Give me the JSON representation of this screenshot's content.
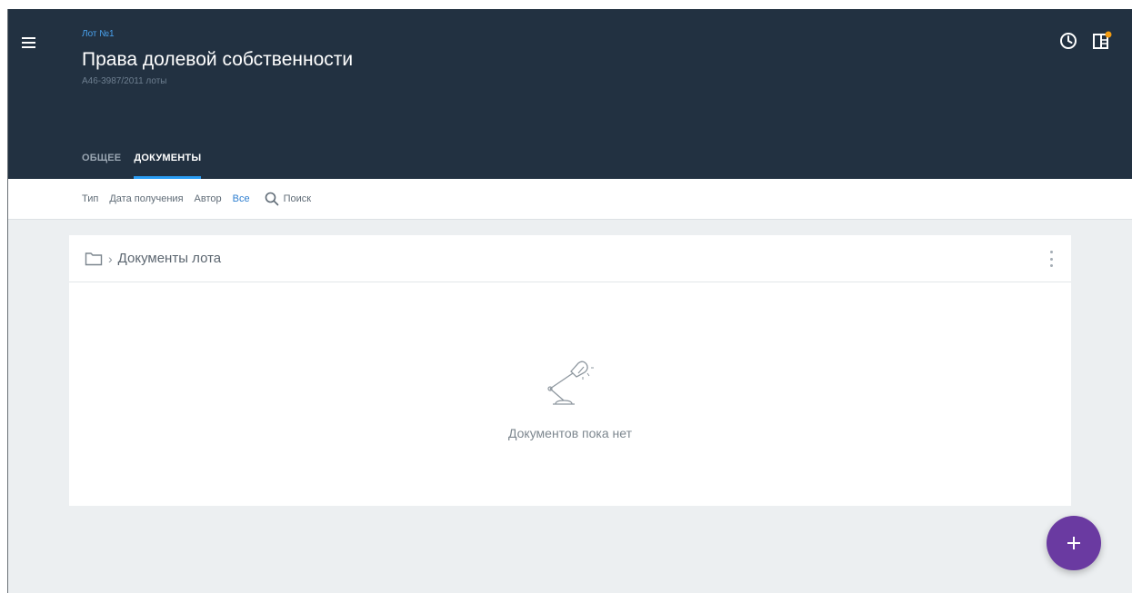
{
  "header": {
    "lot_label": "Лот №1",
    "title": "Права долевой собственности",
    "subtitle": "А46-3987/2011 лоты",
    "icons": [
      "menu-icon",
      "history-icon",
      "panel-icon"
    ],
    "notification_dot_color": "#f39c12",
    "background": "#223141"
  },
  "tabs": [
    {
      "label": "ОБЩЕЕ",
      "active": false
    },
    {
      "label": "ДОКУМЕНТЫ",
      "active": true
    }
  ],
  "filters": {
    "type": "Тип",
    "date": "Дата получения",
    "author": "Автор",
    "all": "Все",
    "search": "Поиск"
  },
  "card": {
    "breadcrumb_sep": "›",
    "title": "Документы лота",
    "empty_text": "Документов пока нет"
  },
  "fab": {
    "icon": "plus-icon",
    "color": "#6a3aa1"
  },
  "colors": {
    "accent": "#2a9df4",
    "link": "#2f7fd0"
  }
}
